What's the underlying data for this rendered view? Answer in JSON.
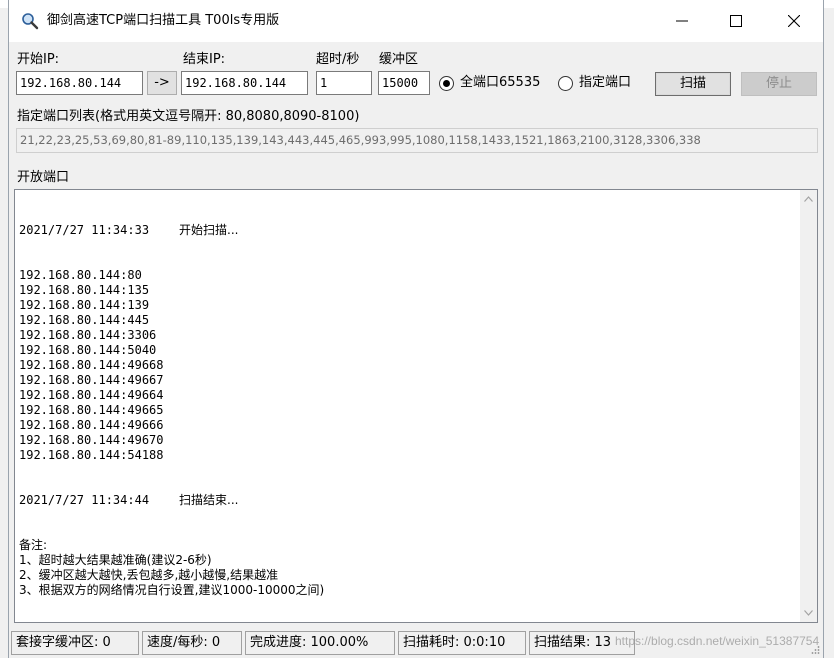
{
  "window": {
    "title": "御剑高速TCP端口扫描工具 T00ls专用版"
  },
  "form": {
    "start_ip_label": "开始IP:",
    "start_ip_value": "192.168.80.144",
    "copy_button": "->",
    "end_ip_label": "结束IP:",
    "end_ip_value": "192.168.80.144",
    "timeout_label": "超时/秒",
    "timeout_value": "1",
    "buffer_label": "缓冲区",
    "buffer_value": "15000",
    "radio_all_label": "全端口65535",
    "radio_specified_label": "指定端口",
    "radio_all_checked": true,
    "scan_button": "扫描",
    "stop_button": "停止",
    "port_list_label": "指定端口列表(格式用英文逗号隔开: 80,8080,8090-8100)",
    "port_list_value": "21,22,23,25,53,69,80,81-89,110,135,139,143,443,445,465,993,995,1080,1158,1433,1521,1863,2100,3128,3306,338",
    "open_ports_label": "开放端口"
  },
  "log": {
    "start_time": "2021/7/27 11:34:33",
    "start_msg": "开始扫描...",
    "results": [
      "192.168.80.144:80",
      "192.168.80.144:135",
      "192.168.80.144:139",
      "192.168.80.144:445",
      "192.168.80.144:3306",
      "192.168.80.144:5040",
      "192.168.80.144:49668",
      "192.168.80.144:49667",
      "192.168.80.144:49664",
      "192.168.80.144:49665",
      "192.168.80.144:49666",
      "192.168.80.144:49670",
      "192.168.80.144:54188"
    ],
    "end_time": "2021/7/27 11:34:44",
    "end_msg": "扫描结束...",
    "notes": [
      "备注:",
      "1、超时越大结果越准确(建议2-6秒)",
      "2、缓冲区越大越快,丢包越多,越小越慢,结果越准",
      "3、根据双方的网络情况自行设置,建议1000-10000之间)"
    ]
  },
  "status": {
    "socket_buffer": "套接字缓冲区: 0",
    "speed": "速度/每秒: 0",
    "progress": "完成进度: 100.00%",
    "elapsed": "扫描耗时: 0:0:10",
    "result": "扫描结果: 13"
  },
  "watermark": "https://blog.csdn.net/weixin_51387754",
  "icons": {
    "app": "magnifier-icon",
    "minimize": "minimize-icon",
    "maximize": "maximize-icon",
    "close": "close-icon"
  },
  "colors": {
    "window_bg": "#f0f0f0",
    "titlebar_bg": "#ffffff",
    "disabled_text": "#8d8d8d"
  }
}
